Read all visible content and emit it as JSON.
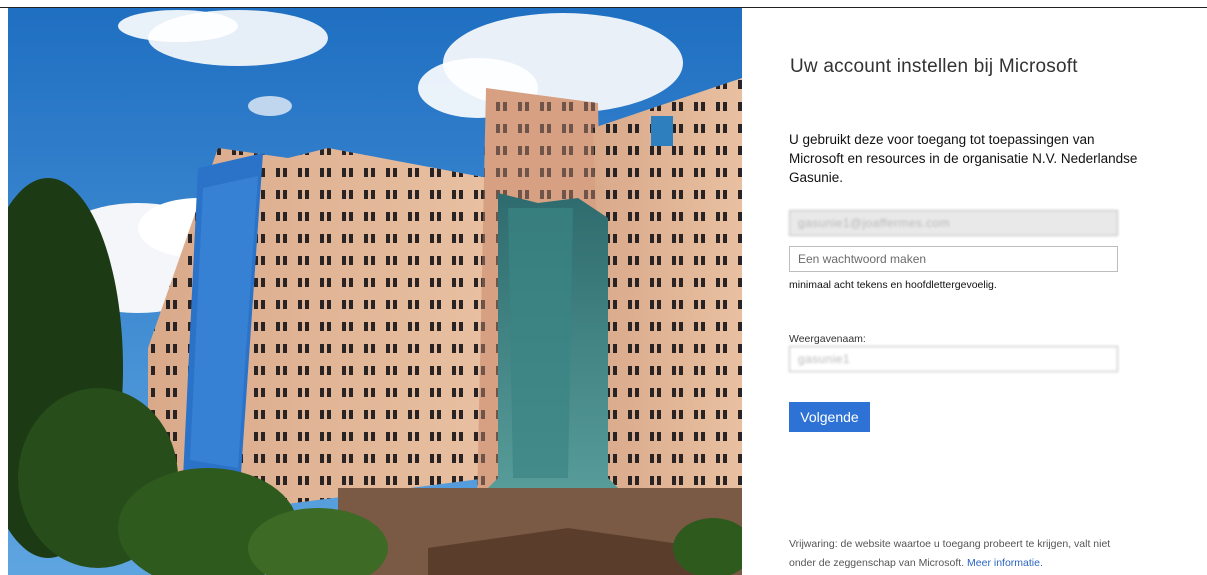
{
  "hero": {
    "image": "building-photo"
  },
  "form": {
    "title": "Uw account instellen bij Microsoft",
    "intro": "U gebruikt deze voor toegang tot toepassingen van Microsoft en resources in de organisatie N.V. Nederlandse Gasunie.",
    "email_value": "gasunie1@joaffermes.com",
    "password_placeholder": "Een wachtwoord maken",
    "password_hint": "minimaal acht tekens en hoofdlettergevoelig.",
    "display_name_label": "Weergavenaam:",
    "display_name_value": "gasunie1",
    "next_button": "Volgende",
    "disclaimer": "Vrijwaring: de website waartoe u toegang probeert te krijgen, valt niet onder de zeggenschap van Microsoft.",
    "more_info_link": "Meer informatie."
  },
  "colors": {
    "accent": "#2f72d6",
    "link": "#2b64c0"
  }
}
